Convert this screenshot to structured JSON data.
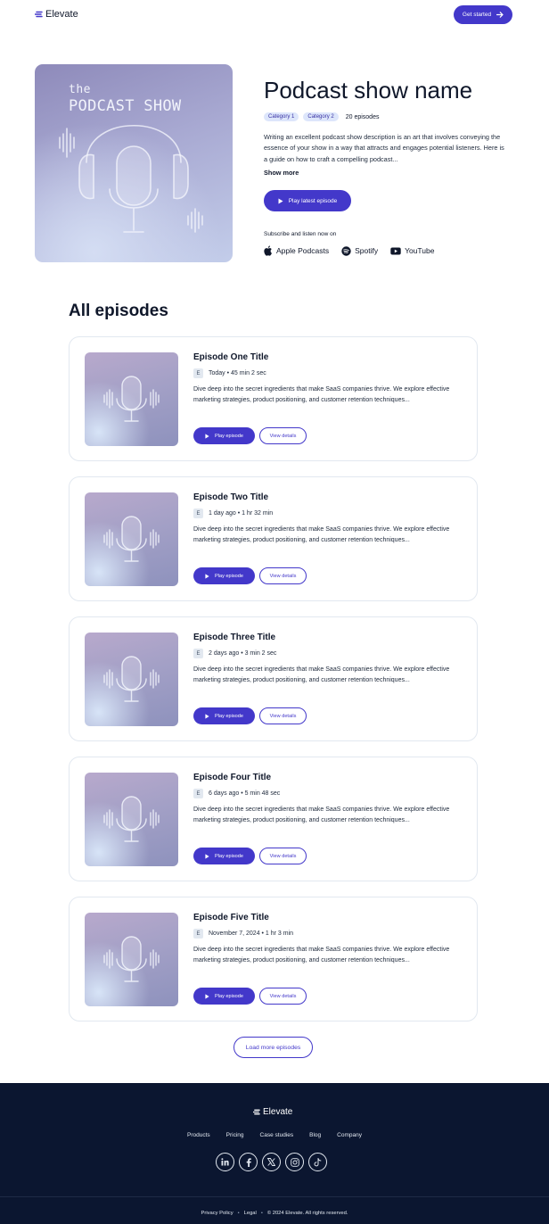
{
  "header": {
    "brand": "Elevate",
    "cta_label": "Get started"
  },
  "hero": {
    "cover_small_text": "the",
    "cover_title": "PODCAST SHOW",
    "show_title": "Podcast show name",
    "tags": [
      "Category 1",
      "Category 2"
    ],
    "episode_count": "20 episodes",
    "description": "Writing an excellent podcast show description is an art that involves conveying the essence of your show in a way that attracts and engages potential listeners. Here is a guide on how to craft a compelling podcast...",
    "show_more_label": "Show more",
    "play_latest_label": "Play latest episode",
    "subscribe_label": "Subscribe and listen now on",
    "platforms": [
      {
        "name": "Apple Podcasts",
        "icon": "apple-icon"
      },
      {
        "name": "Spotify",
        "icon": "spotify-icon"
      },
      {
        "name": "YouTube",
        "icon": "youtube-icon"
      }
    ]
  },
  "episodes": {
    "section_title": "All episodes",
    "explicit_badge": "E",
    "play_label": "Play episode",
    "details_label": "View details",
    "items": [
      {
        "title": "Episode One Title",
        "meta": "Today • 45 min 2 sec",
        "description": "Dive deep into the secret ingredients that make SaaS companies thrive. We explore effective marketing strategies, product positioning, and customer retention techniques..."
      },
      {
        "title": "Episode Two Title",
        "meta": "1 day ago • 1 hr 32 min",
        "description": "Dive deep into the secret ingredients that make SaaS companies thrive. We explore effective marketing strategies, product positioning, and customer retention techniques..."
      },
      {
        "title": "Episode Three Title",
        "meta": "2 days ago • 3 min 2 sec",
        "description": "Dive deep into the secret ingredients that make SaaS companies thrive. We explore effective marketing strategies, product positioning, and customer retention techniques..."
      },
      {
        "title": "Episode Four Title",
        "meta": "6 days ago • 5 min 48 sec",
        "description": "Dive deep into the secret ingredients that make SaaS companies thrive. We explore effective marketing strategies, product positioning, and customer retention techniques..."
      },
      {
        "title": "Episode Five Title",
        "meta": "November 7, 2024 • 1 hr 3 min",
        "description": "Dive deep into the secret ingredients that make SaaS companies thrive. We explore effective marketing strategies, product positioning, and customer retention techniques..."
      }
    ],
    "load_more_label": "Load more episodes"
  },
  "footer": {
    "brand": "Elevate",
    "links": [
      "Products",
      "Pricing",
      "Case studies",
      "Blog",
      "Company"
    ],
    "social": [
      "linkedin-icon",
      "facebook-icon",
      "x-icon",
      "instagram-icon",
      "tiktok-icon"
    ],
    "privacy_label": "Privacy Policy",
    "legal_label": "Legal",
    "copyright": "© 2024 Elevate. All rights reserved."
  },
  "colors": {
    "accent": "#4338ca",
    "footer_bg": "#0b1630",
    "tag_bg": "#dde6fb"
  }
}
